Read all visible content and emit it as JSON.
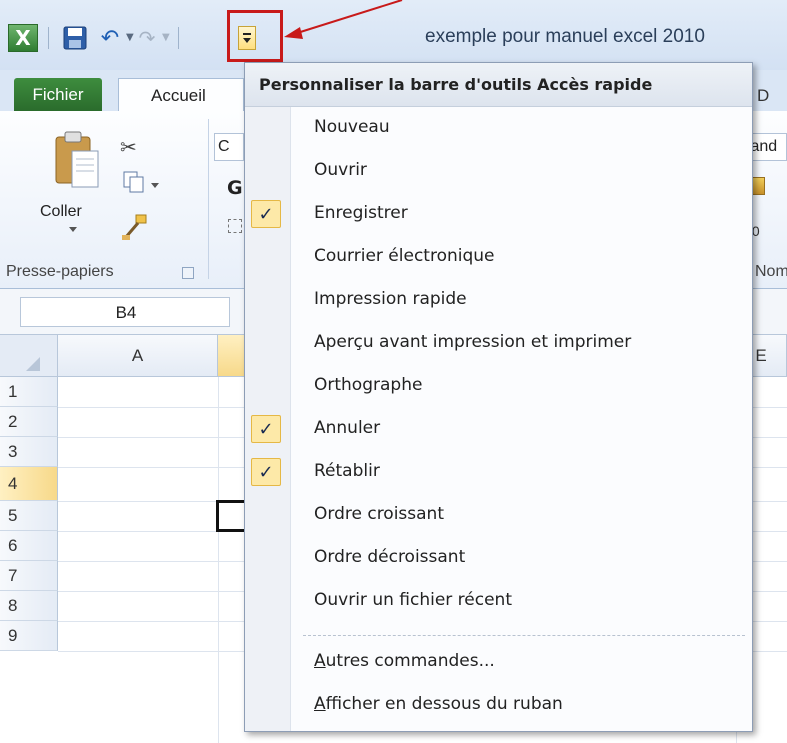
{
  "window": {
    "title": "exemple pour manuel excel 2010"
  },
  "quick_access_toolbar": {
    "excel_glyph": "X",
    "undo_glyph": "↶",
    "redo_glyph": "↷"
  },
  "tabs": {
    "file": "Fichier",
    "home": "Accueil",
    "right_partial": "D"
  },
  "ribbon": {
    "paste_label": "Coller",
    "clipboard_group_label": "Presse-papiers",
    "font_name_partial": "C",
    "bold_glyph": "G",
    "number_format_partial": "tand",
    "number_group_partial": "Nom",
    "cut_glyph": "✂"
  },
  "formula_bar": {
    "name_box": "B4"
  },
  "grid": {
    "columns": [
      "A",
      "",
      "E"
    ],
    "rows": [
      "1",
      "2",
      "3",
      "4",
      "5",
      "6",
      "7",
      "8",
      "9"
    ],
    "active_row": "4"
  },
  "qat_menu": {
    "header": "Personnaliser la barre d'outils Accès rapide",
    "items": [
      {
        "label": "Nouveau",
        "checked": false
      },
      {
        "label": "Ouvrir",
        "checked": false
      },
      {
        "label": "Enregistrer",
        "checked": true
      },
      {
        "label": "Courrier électronique",
        "checked": false
      },
      {
        "label": "Impression rapide",
        "checked": false
      },
      {
        "label": "Aperçu avant impression et imprimer",
        "checked": false
      },
      {
        "label": "Orthographe",
        "checked": false
      },
      {
        "label": "Annuler",
        "checked": true
      },
      {
        "label": "Rétablir",
        "checked": true
      },
      {
        "label": "Ordre croissant",
        "checked": false
      },
      {
        "label": "Ordre décroissant",
        "checked": false
      },
      {
        "label": "Ouvrir un fichier récent",
        "checked": false
      }
    ],
    "more_commands": {
      "first": "A",
      "rest": "utres commandes..."
    },
    "show_below_ribbon": {
      "first": "A",
      "rest": "fficher en dessous du ruban"
    },
    "check_glyph": "✓"
  },
  "colors": {
    "highlight_box": "#c81a1a",
    "file_tab": "#2f7d32",
    "check_background": "#fde9a8"
  }
}
